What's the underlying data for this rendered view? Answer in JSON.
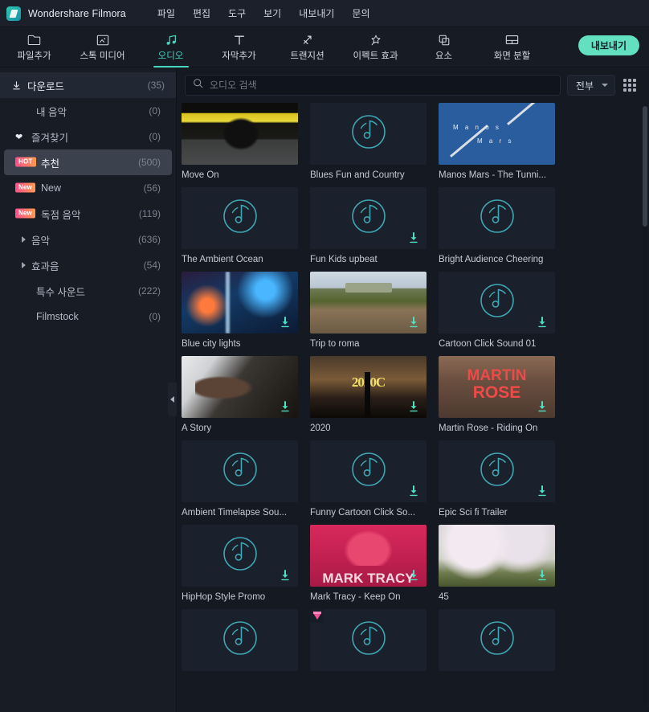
{
  "titlebar": {
    "app_title": "Wondershare Filmora",
    "logo": "filmora-logo",
    "menus": [
      "파일",
      "편집",
      "도구",
      "보기",
      "내보내기",
      "문의"
    ]
  },
  "toolbar": {
    "tabs": [
      {
        "label": "파일추가",
        "icon": "folder-icon",
        "active": false
      },
      {
        "label": "스톡 미디어",
        "icon": "stock-media-icon",
        "active": false
      },
      {
        "label": "오디오",
        "icon": "music-note-icon",
        "active": true
      },
      {
        "label": "자막추가",
        "icon": "text-icon",
        "active": false
      },
      {
        "label": "트랜지션",
        "icon": "transition-icon",
        "active": false
      },
      {
        "label": "이펙트 효과",
        "icon": "effects-icon",
        "active": false
      },
      {
        "label": "요소",
        "icon": "elements-icon",
        "active": false
      },
      {
        "label": "화면 분할",
        "icon": "split-screen-icon",
        "active": false
      }
    ],
    "export_label": "내보내기",
    "export_color": "#63e0c0"
  },
  "sidebar": {
    "items": [
      {
        "label": "다운로드",
        "count": "(35)",
        "icon": "download-icon",
        "badge": null,
        "style": "header",
        "indent": false
      },
      {
        "label": "내 음악",
        "count": "(0)",
        "icon": null,
        "badge": null,
        "style": "normal",
        "indent": true
      },
      {
        "label": "즐겨찾기",
        "count": "(0)",
        "icon": "heart-icon",
        "badge": null,
        "style": "normal",
        "indent": false
      },
      {
        "label": "추천",
        "count": "(500)",
        "icon": null,
        "badge": "HOT",
        "style": "selected",
        "indent": false
      },
      {
        "label": "New",
        "count": "(56)",
        "icon": null,
        "badge": "New",
        "style": "normal",
        "indent": false
      },
      {
        "label": "독점 음악",
        "count": "(119)",
        "icon": null,
        "badge": "New",
        "style": "normal",
        "indent": false
      },
      {
        "label": "음악",
        "count": "(636)",
        "icon": "caret-right-icon",
        "badge": null,
        "style": "normal",
        "indent": false
      },
      {
        "label": "효과음",
        "count": "(54)",
        "icon": "caret-right-icon",
        "badge": null,
        "style": "normal",
        "indent": false
      },
      {
        "label": "특수 사운드",
        "count": "(222)",
        "icon": null,
        "badge": null,
        "style": "normal",
        "indent": true
      },
      {
        "label": "Filmstock",
        "count": "(0)",
        "icon": null,
        "badge": null,
        "style": "normal",
        "indent": true
      }
    ],
    "collapse_icon": "collapse-left-icon",
    "badge_colors": {
      "hot": "#ff4e8d",
      "new": "#ff9a4d"
    }
  },
  "search": {
    "placeholder": "오디오 검색",
    "value": "",
    "icon": "search-icon",
    "filter_label": "전부",
    "grid_view_icon": "grid-view-icon"
  },
  "grid": {
    "items": [
      {
        "title": "Move On",
        "art": "art-moveon",
        "downloadable": false,
        "premium": false
      },
      {
        "title": "Blues Fun and Country",
        "art": "placeholder",
        "downloadable": false,
        "premium": false
      },
      {
        "title": "Manos Mars - The Tunni...",
        "art": "art-manos",
        "downloadable": false,
        "premium": false
      },
      {
        "title": "The Ambient Ocean",
        "art": "placeholder",
        "downloadable": false,
        "premium": false
      },
      {
        "title": "Fun Kids upbeat",
        "art": "placeholder",
        "downloadable": true,
        "premium": false
      },
      {
        "title": "Bright Audience Cheering",
        "art": "placeholder",
        "downloadable": false,
        "premium": false
      },
      {
        "title": "Blue city lights",
        "art": "art-city",
        "downloadable": true,
        "premium": false
      },
      {
        "title": "Trip to roma",
        "art": "art-roma",
        "downloadable": true,
        "premium": false
      },
      {
        "title": "Cartoon Click Sound 01",
        "art": "placeholder",
        "downloadable": true,
        "premium": false
      },
      {
        "title": "A Story",
        "art": "art-piano",
        "downloadable": true,
        "premium": false
      },
      {
        "title": "2020",
        "art": "art-2020",
        "downloadable": true,
        "premium": false
      },
      {
        "title": "Martin Rose - Riding On",
        "art": "art-martin",
        "downloadable": true,
        "premium": false
      },
      {
        "title": "Ambient Timelapse Sou...",
        "art": "placeholder",
        "downloadable": false,
        "premium": false
      },
      {
        "title": "Funny Cartoon Click So...",
        "art": "placeholder",
        "downloadable": true,
        "premium": false
      },
      {
        "title": "Epic Sci fi Trailer",
        "art": "placeholder",
        "downloadable": true,
        "premium": false
      },
      {
        "title": "HipHop Style Promo",
        "art": "placeholder",
        "downloadable": true,
        "premium": false
      },
      {
        "title": "Mark Tracy - Keep On",
        "art": "art-marktracy",
        "downloadable": true,
        "premium": false
      },
      {
        "title": "45",
        "art": "art-sakura",
        "downloadable": true,
        "premium": false
      },
      {
        "title": "",
        "art": "placeholder",
        "downloadable": false,
        "premium": false
      },
      {
        "title": "",
        "art": "placeholder",
        "downloadable": false,
        "premium": true
      },
      {
        "title": "",
        "art": "placeholder",
        "downloadable": false,
        "premium": false
      }
    ],
    "art_text": {
      "manos_line1": "M a n o s",
      "manos_line2": "M a r s",
      "year_2020": "2020C",
      "martin_line1": "MARTIN",
      "martin_line2": "ROSE",
      "marktracy": "MARK TRACY"
    },
    "placeholder_icon": "music-disc-icon",
    "download_icon": "download-arrow-icon",
    "premium_icon": "diamond-icon",
    "accent_color": "#46b8bd"
  }
}
